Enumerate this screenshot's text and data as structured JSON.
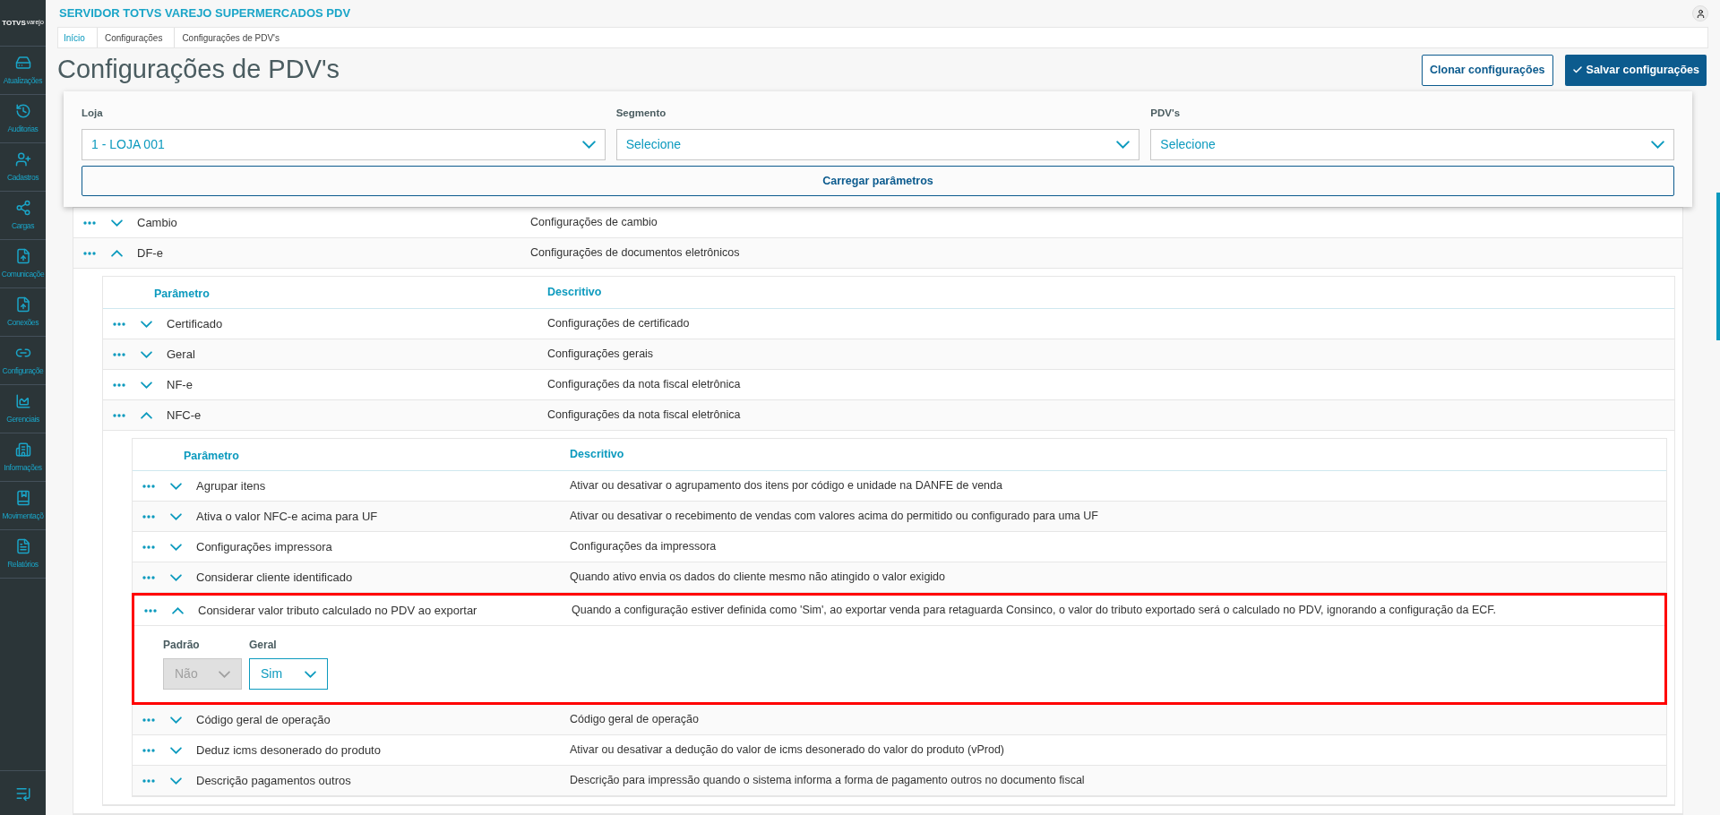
{
  "app": {
    "title": "SERVIDOR TOTVS VAREJO SUPERMERCADOS PDV"
  },
  "sidebar": {
    "logo": "TOTVS",
    "logo_sub": "varejo",
    "items": [
      {
        "label": "Atualizações"
      },
      {
        "label": "Auditorias"
      },
      {
        "label": "Cadastros"
      },
      {
        "label": "Cargas"
      },
      {
        "label": "Comunicaçõe"
      },
      {
        "label": "Conexões"
      },
      {
        "label": "Configuraçõe"
      },
      {
        "label": "Gerenciais"
      },
      {
        "label": "Informações"
      },
      {
        "label": "Movimentaçõ"
      },
      {
        "label": "Relatórios"
      }
    ]
  },
  "breadcrumb": [
    {
      "label": "Início",
      "kind": "link"
    },
    {
      "label": "Configurações",
      "kind": "text"
    },
    {
      "label": "Configurações de PDV's",
      "kind": "text"
    }
  ],
  "page_title": "Configurações de PDV's",
  "actions": [
    {
      "label": "Clonar configurações",
      "kind": "secondary"
    },
    {
      "label": "Salvar configurações",
      "kind": "primary"
    }
  ],
  "filters": [
    {
      "label": "Loja",
      "value": "1 - LOJA 001"
    },
    {
      "label": "Segmento",
      "placeholder": "Selecione"
    },
    {
      "label": "PDV's",
      "placeholder": "Selecione"
    }
  ],
  "load_button": "Carregar parâmetros",
  "params_table": {
    "rows": [
      {
        "name": "Cambio",
        "description": "Configurações de cambio",
        "expanded": false
      },
      {
        "name": "DF-e",
        "description": "Configurações de documentos eletrônicos",
        "expanded": true,
        "table": {
          "columns": [
            "Parâmetro",
            "Descritivo"
          ],
          "rows": [
            {
              "name": "Certificado",
              "description": "Configurações de certificado",
              "expanded": false
            },
            {
              "name": "Geral",
              "description": "Configurações gerais",
              "expanded": false
            },
            {
              "name": "NF-e",
              "description": "Configurações da nota fiscal eletrônica",
              "expanded": false
            },
            {
              "name": "NFC-e",
              "description": "Configurações da nota fiscal eletrônica",
              "expanded": true,
              "table": {
                "columns": [
                  "Parâmetro",
                  "Descritivo"
                ],
                "rows": [
                  {
                    "name": "Agrupar itens",
                    "description": "Ativar ou desativar o agrupamento dos itens por código e unidade na DANFE de venda",
                    "expanded": false,
                    "highlighted": false
                  },
                  {
                    "name": "Ativa o valor NFC-e acima para UF",
                    "description": "Ativar ou desativar o recebimento de vendas com valores acima do permitido ou configurado para uma UF",
                    "expanded": false,
                    "highlighted": false
                  },
                  {
                    "name": "Configurações impressora",
                    "description": "Configurações da impressora",
                    "expanded": false,
                    "highlighted": false
                  },
                  {
                    "name": "Considerar cliente identificado",
                    "description": "Quando ativo envia os dados do cliente mesmo não atingido o valor exigido",
                    "expanded": false,
                    "highlighted": false
                  },
                  {
                    "name": "Considerar valor tributo calculado no PDV ao exportar",
                    "description": "Quando a configuração estiver definida como 'Sim', ao exportar venda para retaguarda Consinco, o valor do tributo exportado será o calculado no PDV, ignorando a configuração da ECF.",
                    "expanded": true,
                    "highlighted": true,
                    "settings": [
                      {
                        "label": "Padrão",
                        "value": "Não",
                        "disabled": true
                      },
                      {
                        "label": "Geral",
                        "value": "Sim",
                        "disabled": false
                      }
                    ]
                  },
                  {
                    "name": "Código geral de operação",
                    "description": "Código geral de operação",
                    "expanded": false,
                    "highlighted": false
                  },
                  {
                    "name": "Deduz icms desonerado do produto",
                    "description": "Ativar ou desativar a dedução do valor de icms desonerado do valor do produto (vProd)",
                    "expanded": false,
                    "highlighted": false
                  },
                  {
                    "name": "Descrição pagamentos outros",
                    "description": "Descrição para impressão quando o sistema informa a forma de pagamento outros no documento fiscal",
                    "expanded": false,
                    "highlighted": false
                  }
                ]
              }
            }
          ]
        }
      }
    ]
  }
}
